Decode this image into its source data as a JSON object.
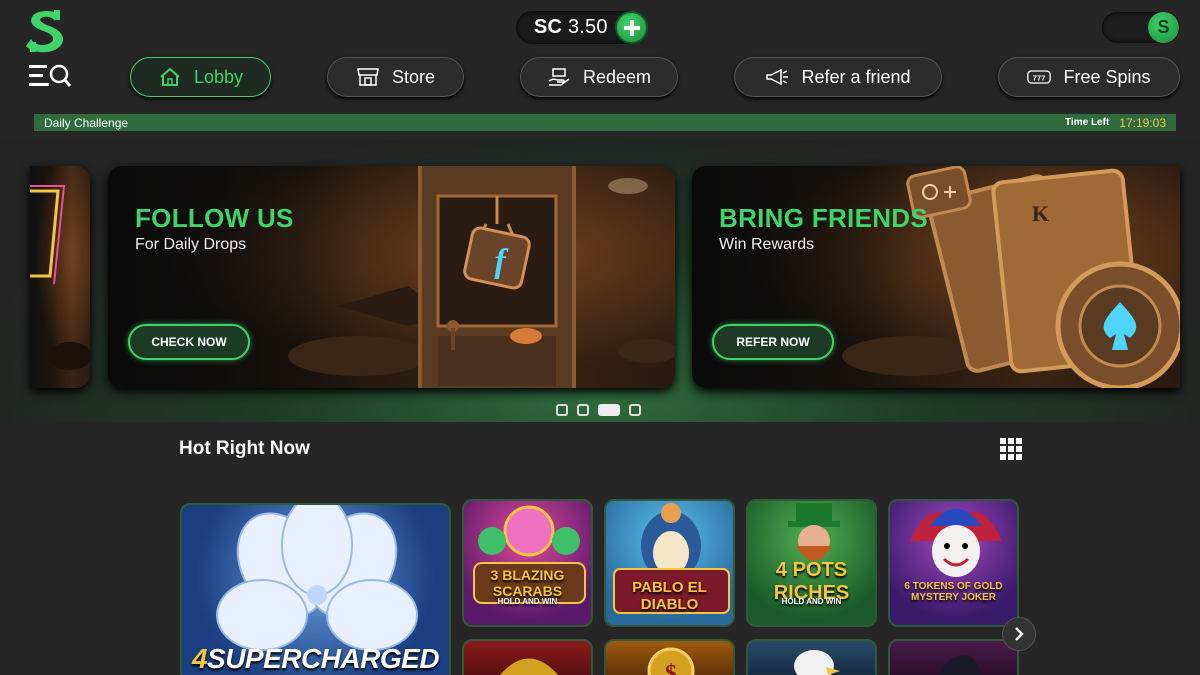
{
  "header": {
    "balance_currency": "SC",
    "balance_amount": "3.50",
    "toggle_symbol": "S"
  },
  "nav": [
    {
      "label": "Lobby",
      "icon": "home-icon",
      "active": true
    },
    {
      "label": "Store",
      "icon": "store-icon",
      "active": false
    },
    {
      "label": "Redeem",
      "icon": "redeem-icon",
      "active": false
    },
    {
      "label": "Refer a friend",
      "icon": "megaphone-icon",
      "active": false
    },
    {
      "label": "Free Spins",
      "icon": "slot-777-icon",
      "active": false
    }
  ],
  "challenge": {
    "label": "Daily Challenge",
    "time_left_label": "Time Left",
    "timer": "17:19:03"
  },
  "banners": [
    {
      "title": "FOLLOW US",
      "subtitle": "For Daily Drops",
      "button": "CHECK NOW"
    },
    {
      "title": "BRING FRIENDS",
      "subtitle": "Win Rewards",
      "button": "REFER NOW"
    }
  ],
  "section": {
    "title": "Hot Right Now"
  },
  "games": [
    {
      "name": "SUPERCHARGED",
      "prefix": "4"
    },
    {
      "name": "3 BLAZING SCARABS",
      "tagline": "HOLD AND WIN"
    },
    {
      "name": "PABLO EL DIABLO"
    },
    {
      "name": "4 POTS RICHES",
      "tagline": "HOLD AND WIN"
    },
    {
      "name": "6 TOKENS OF GOLD MYSTERY JOKER"
    }
  ],
  "colors": {
    "accent": "#3fd36a",
    "timer": "#f2c94c",
    "challenge_bar": "#2f6b3d",
    "background": "#262626"
  }
}
